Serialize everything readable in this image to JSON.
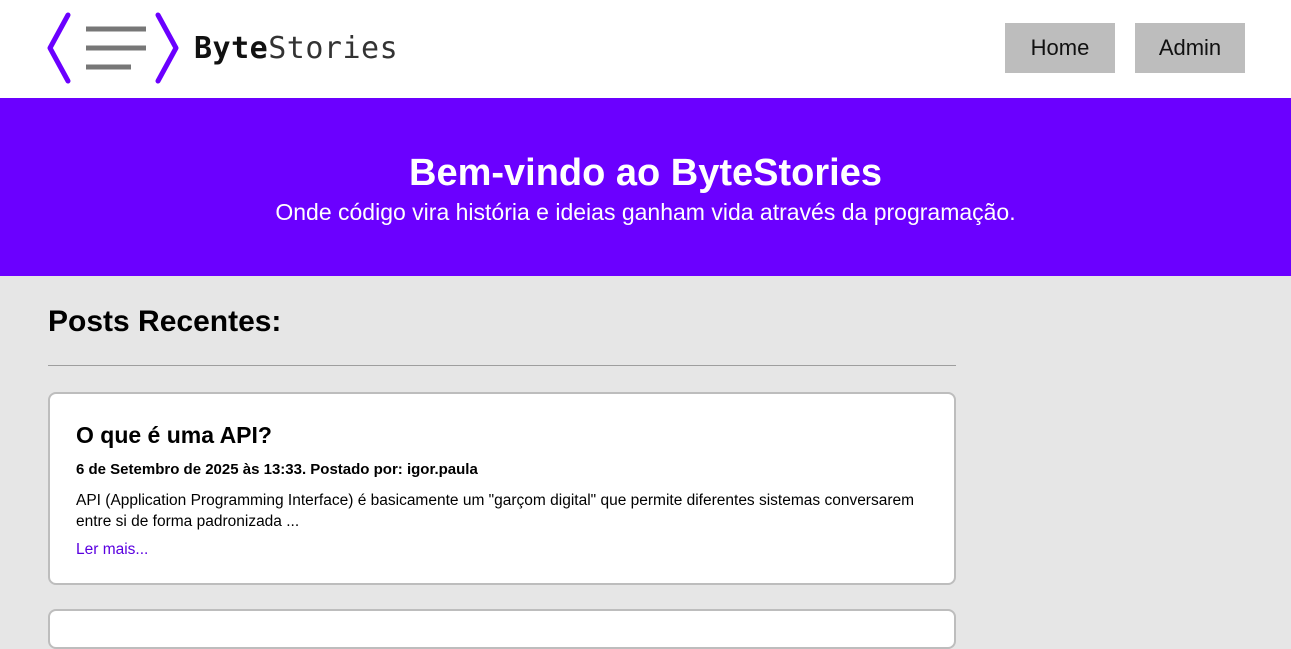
{
  "header": {
    "brand_bold": "Byte",
    "brand_rest": "Stories",
    "nav": {
      "home_label": "Home",
      "admin_label": "Admin"
    }
  },
  "hero": {
    "title": "Bem-vindo ao ByteStories",
    "subtitle": "Onde código vira história e ideias ganham vida através da programação."
  },
  "main": {
    "section_title": "Posts Recentes:",
    "posts": [
      {
        "title": "O que é uma API?",
        "meta": "6 de Setembro de 2025 às 13:33. Postado por: igor.paula",
        "excerpt": "API (Application Programming Interface) é basicamente um \"garçom digital\" que permite diferentes sistemas conversarem entre si de forma padronizada ...",
        "read_more": "Ler mais..."
      }
    ]
  },
  "colors": {
    "accent": "#6b00ff",
    "logo_bracket": "#6b00ff",
    "logo_lines": "#777777",
    "page_bg": "#e6e6e6",
    "nav_button_bg": "#bdbdbd",
    "link": "#5a00e0"
  }
}
